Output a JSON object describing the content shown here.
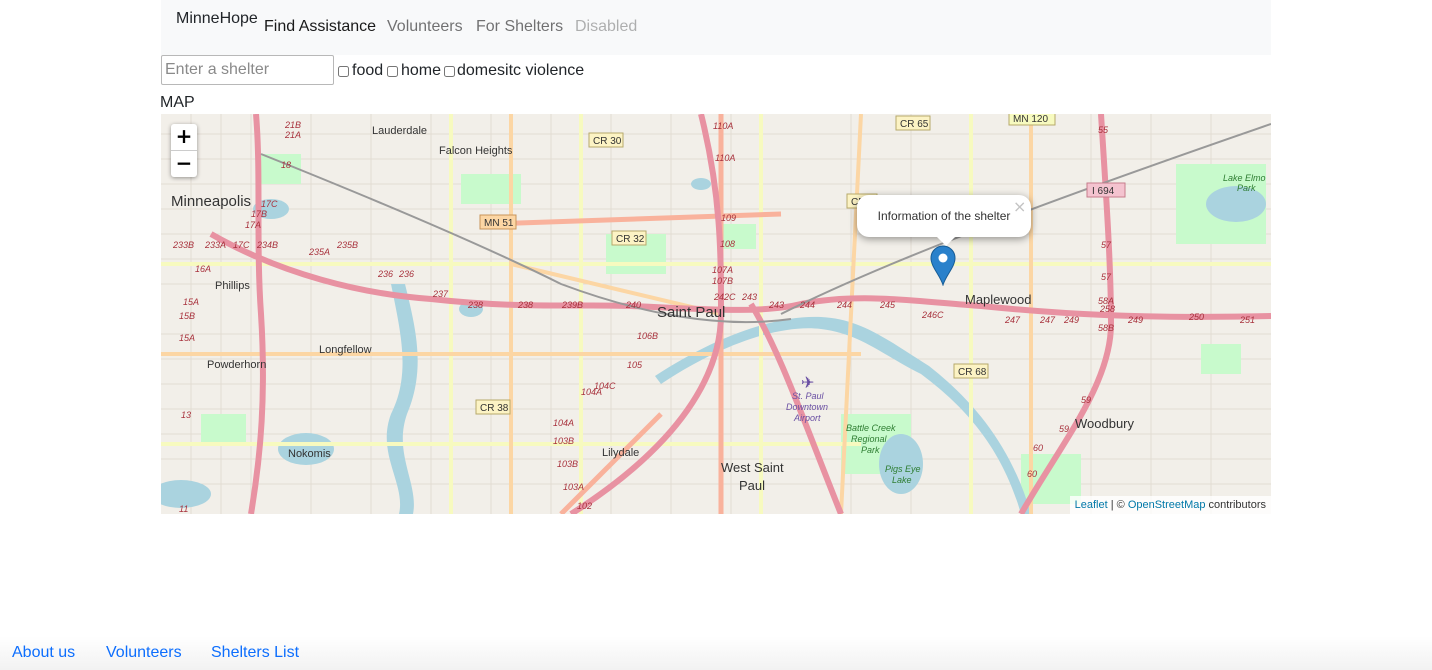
{
  "navbar": {
    "brand": "MinneHope",
    "links": [
      "Find Assistance",
      "Volunteers",
      "For Shelters",
      "Disabled"
    ]
  },
  "filters": {
    "search_placeholder": "Enter a shelter",
    "search_value": "",
    "options": [
      {
        "label": "food",
        "checked": false
      },
      {
        "label": "home",
        "checked": false
      },
      {
        "label": "domesitc violence",
        "checked": false
      }
    ]
  },
  "map": {
    "section_label": "MAP",
    "zoom_in": "+",
    "zoom_out": "−",
    "popup_text": "Information of the shelter",
    "popup_close": "×",
    "attribution": {
      "leaflet": "Leaflet",
      "sep": " | © ",
      "osm": "OpenStreetMap",
      "suffix": " contributors"
    },
    "places": [
      "Lauderdale",
      "Falcon Heights",
      "Minneapolis",
      "Phillips",
      "Powderhorn",
      "Longfellow",
      "Nokomis",
      "Saint Paul",
      "Lilydale",
      "West Saint",
      "Paul",
      "Maplewood",
      "Woodbury",
      "Lake Elmo",
      "Park",
      "St. Paul",
      "Downtown",
      "Airport",
      "Battle Creek",
      "Regional",
      "Park",
      "Pigs Eye",
      "Lake"
    ],
    "road_shields": [
      "CR 30",
      "CR 32",
      "MN 51",
      "CR 38",
      "CR 65",
      "MN 120",
      "I 694",
      "CR 68",
      "CR 5"
    ],
    "exit_numbers": [
      "21B",
      "21A",
      "18",
      "17C",
      "17B",
      "17A",
      "233B",
      "233A",
      "17C",
      "234B",
      "235A",
      "235B",
      "236",
      "236",
      "237",
      "238",
      "238",
      "239B",
      "240",
      "242C",
      "243",
      "243",
      "244",
      "244",
      "245",
      "246C",
      "247",
      "247",
      "249",
      "249",
      "250",
      "251",
      "16A",
      "15A",
      "15B",
      "15A",
      "13",
      "11",
      "110A",
      "110A",
      "109",
      "108",
      "107A",
      "107B",
      "106B",
      "105",
      "104C",
      "104A",
      "104A",
      "103B",
      "103B",
      "103A",
      "102",
      "55",
      "57",
      "57",
      "58A",
      "58B",
      "258",
      "59",
      "59",
      "60",
      "60"
    ],
    "colors": {
      "water": "#aad3df",
      "park": "#c8facc",
      "land": "#f2efe9",
      "motorway": "#e892a2",
      "trunk": "#f9b29c",
      "primary": "#fcd6a4",
      "secondary": "#f7fabf",
      "marker": "#2a81cb"
    }
  },
  "footer": {
    "links": [
      "About us",
      "Volunteers",
      "Shelters List"
    ]
  }
}
